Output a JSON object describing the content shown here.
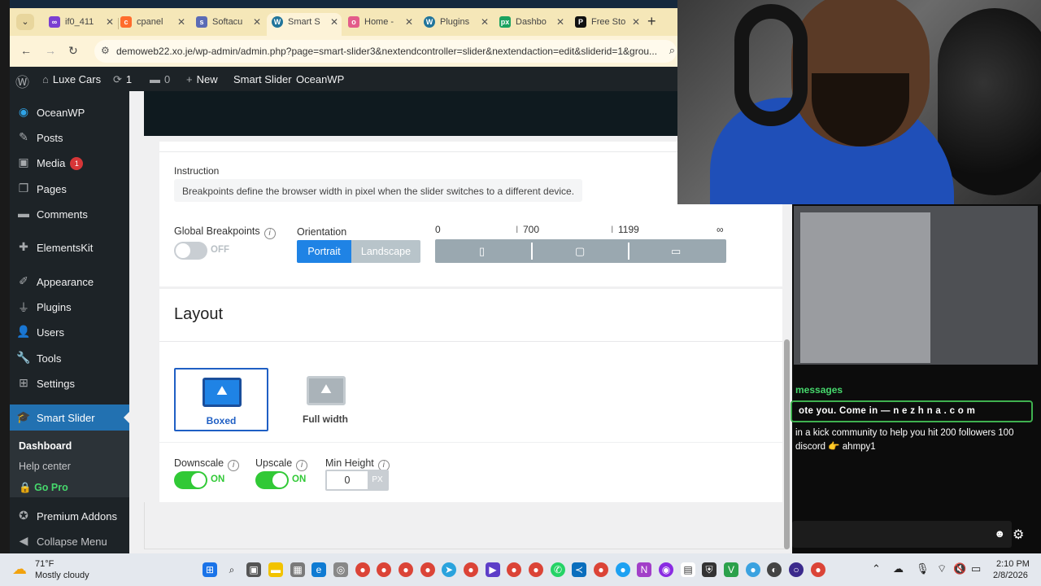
{
  "browser": {
    "tabs": [
      {
        "label": "if0_411",
        "icon": "infinity-icon",
        "color": "#7b3fd1"
      },
      {
        "label": "cpanel",
        "icon": "cpanel-icon",
        "color": "#ff6c2c"
      },
      {
        "label": "Softacu",
        "icon": "softaculous-icon",
        "color": "#5b6bb5"
      },
      {
        "label": "Smart S",
        "icon": "wordpress-icon",
        "color": "#21759b"
      },
      {
        "label": "Home -",
        "icon": "oceanwp-icon",
        "color": "#e35c8a"
      },
      {
        "label": "Plugins",
        "icon": "wordpress-icon",
        "color": "#21759b"
      },
      {
        "label": "Dashbo",
        "icon": "px-icon",
        "color": "#1aa260"
      },
      {
        "label": "Free Sto",
        "icon": "pexels-icon",
        "color": "#111111"
      }
    ],
    "url": "demoweb22.xo.je/wp-admin/admin.php?page=smart-slider3&nextendcontroller=slider&nextendaction=edit&sliderid=1&grou..."
  },
  "adminbar": {
    "site": "Luxe Cars",
    "updates": "1",
    "comments": "0",
    "new": "New",
    "smart_slider": "Smart Slider",
    "oceanwp": "OceanWP"
  },
  "sidebar": {
    "items": [
      {
        "label": "OceanWP",
        "icon": "oceanwp-icon"
      },
      {
        "label": "Posts",
        "icon": "pin-icon"
      },
      {
        "label": "Media",
        "icon": "media-icon",
        "badge": "1"
      },
      {
        "label": "Pages",
        "icon": "pages-icon"
      },
      {
        "label": "Comments",
        "icon": "comments-icon"
      },
      {
        "label": "ElementsKit",
        "icon": "elementskit-icon"
      },
      {
        "label": "Appearance",
        "icon": "brush-icon"
      },
      {
        "label": "Plugins",
        "icon": "plugin-icon"
      },
      {
        "label": "Users",
        "icon": "users-icon"
      },
      {
        "label": "Tools",
        "icon": "wrench-icon"
      },
      {
        "label": "Settings",
        "icon": "settings-icon"
      },
      {
        "label": "Smart Slider",
        "icon": "smart-slider-icon"
      }
    ],
    "submenu": [
      "Dashboard",
      "Help center",
      "Go Pro"
    ],
    "bottom": [
      {
        "label": "Premium Addons",
        "icon": "premium-addons-icon"
      },
      {
        "label": "Collapse Menu",
        "icon": "collapse-icon"
      }
    ]
  },
  "breakpoints": {
    "instruction_label": "Instruction",
    "instruction_text": "Breakpoints define the browser width in pixel when the slider switches to a different device.",
    "global_label": "Global Breakpoints",
    "global_state": "OFF",
    "orientation_label": "Orientation",
    "portrait": "Portrait",
    "landscape": "Landscape",
    "values": [
      "0",
      "700",
      "1199",
      "∞"
    ]
  },
  "layout": {
    "title": "Layout",
    "boxed": "Boxed",
    "full_width": "Full width",
    "downscale_label": "Downscale",
    "downscale_state": "ON",
    "upscale_label": "Upscale",
    "upscale_state": "ON",
    "min_height_label": "Min Height",
    "min_height_value": "0",
    "min_height_unit": "PX"
  },
  "stream": {
    "messages_title": "messages",
    "highlight": "ote you. Come in — n e z h n a . c o m",
    "message": "in a kick community to help you hit 200 followers 100 discord 👉 ahmpy1"
  },
  "taskbar": {
    "temp": "71°F",
    "weather": "Mostly cloudy",
    "time": "2:10 PM",
    "date": "2/8/2026"
  }
}
